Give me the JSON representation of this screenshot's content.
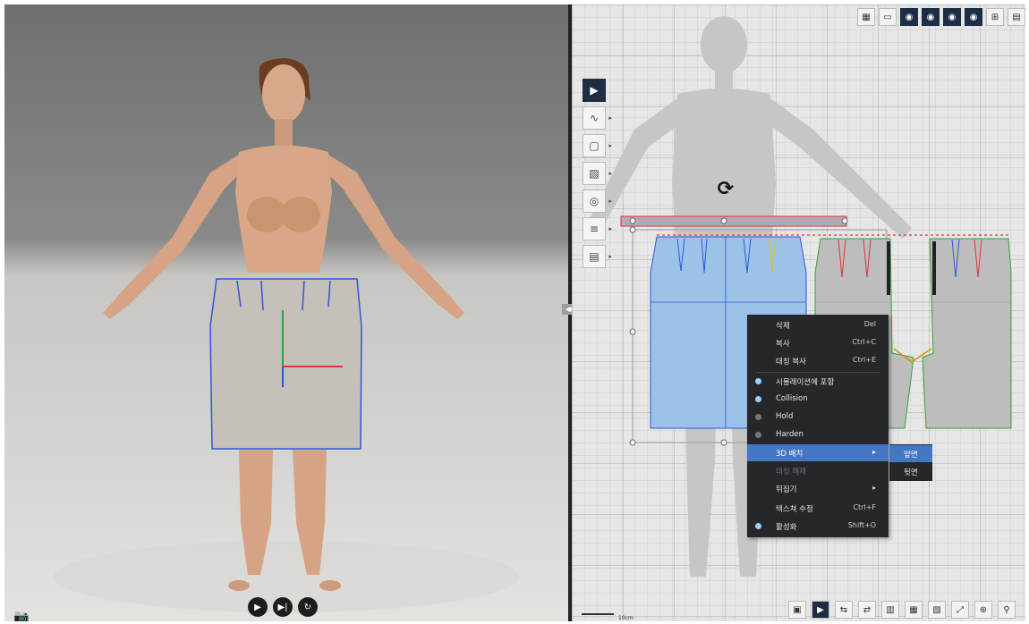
{
  "viewport3d": {
    "controls": {
      "play_icon": "play-icon",
      "step_icon": "step-forward-icon",
      "reset_icon": "reset-icon"
    },
    "camera_icon": "camera-icon"
  },
  "viewport2d": {
    "scale_label": "10cm",
    "toolbar_top": [
      "layer-icon",
      "layout-icon",
      "view-icon",
      "view-icon",
      "view-icon",
      "view-icon",
      "grid-icon",
      "sheet-icon"
    ],
    "tools": [
      "select-icon",
      "curve-icon",
      "rectangle-icon",
      "sewing-icon",
      "globe-icon",
      "grid-icon",
      "layer-icon"
    ]
  },
  "context_menu": {
    "items": [
      {
        "label": "삭제",
        "shortcut": "Del",
        "dot": "",
        "state": "normal"
      },
      {
        "label": "복사",
        "shortcut": "Ctrl+C",
        "dot": "",
        "state": "normal"
      },
      {
        "label": "대칭 복사",
        "shortcut": "Ctrl+E",
        "dot": "",
        "state": "normal"
      },
      {
        "label": "시뮬레이션에 포함",
        "shortcut": "",
        "dot": "#9bd1ff",
        "state": "normal"
      },
      {
        "label": "Collision",
        "shortcut": "",
        "dot": "#9bd1ff",
        "state": "normal"
      },
      {
        "label": "Hold",
        "shortcut": "",
        "dot": "#777777",
        "state": "normal"
      },
      {
        "label": "Harden",
        "shortcut": "",
        "dot": "#777777",
        "state": "normal"
      },
      {
        "label": "3D 배치",
        "shortcut": "▸",
        "dot": "",
        "state": "highlight"
      },
      {
        "label": "대칭 해제",
        "shortcut": "",
        "dot": "",
        "state": "disabled"
      },
      {
        "label": "뒤집기",
        "shortcut": "▸",
        "dot": "",
        "state": "normal"
      },
      {
        "label": "텍스쳐 수정",
        "shortcut": "Ctrl+F",
        "dot": "",
        "state": "normal"
      },
      {
        "label": "활성화",
        "shortcut": "Shift+O",
        "dot": "#9bd1ff",
        "state": "normal"
      }
    ],
    "submenu": [
      {
        "label": "앞면",
        "state": "highlight"
      },
      {
        "label": "뒷면",
        "state": "normal"
      }
    ]
  }
}
